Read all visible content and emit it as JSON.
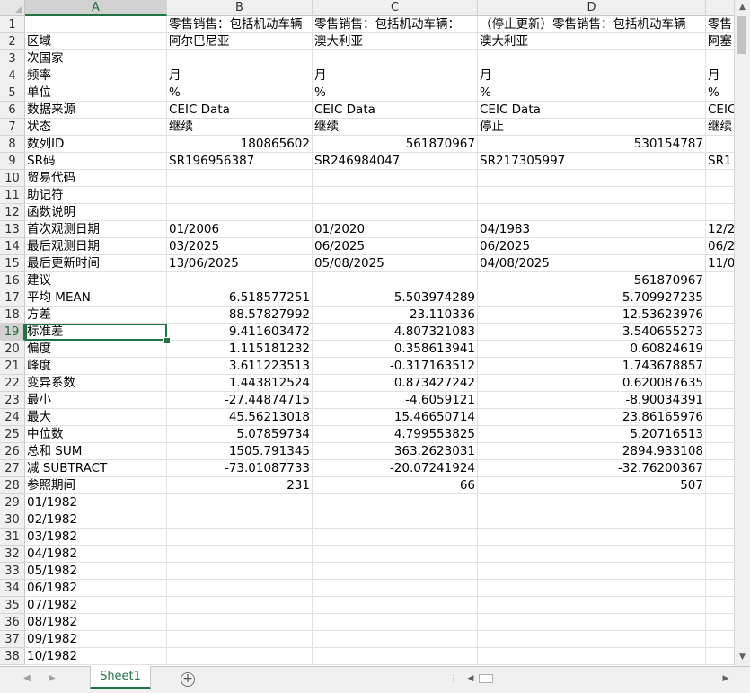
{
  "columns": [
    "A",
    "B",
    "C",
    "D",
    ""
  ],
  "active_cell": {
    "row": 19,
    "col": "A"
  },
  "row_numbers": [
    "1",
    "2",
    "3",
    "4",
    "5",
    "6",
    "7",
    "8",
    "9",
    "10",
    "11",
    "12",
    "13",
    "14",
    "15",
    "16",
    "17",
    "18",
    "19",
    "20",
    "21",
    "22",
    "23",
    "24",
    "25",
    "26",
    "27",
    "28",
    "29",
    "30",
    "31",
    "32",
    "33",
    "34",
    "35",
    "36",
    "37",
    "38"
  ],
  "rows": [
    [
      "",
      "零售销售：包括机动车辆",
      "零售销售：包括机动车辆：",
      "（停止更新）零售销售：包括机动车辆",
      "零售"
    ],
    [
      "区域",
      "阿尔巴尼亚",
      "澳大利亚",
      "澳大利亚",
      "阿塞"
    ],
    [
      "次国家",
      "",
      "",
      "",
      ""
    ],
    [
      "频率",
      "月",
      "月",
      "月",
      "月"
    ],
    [
      "单位",
      "%",
      "%",
      "%",
      "%"
    ],
    [
      "数据来源",
      "CEIC Data",
      "CEIC Data",
      "CEIC Data",
      "CEIC"
    ],
    [
      "状态",
      "继续",
      "继续",
      "停止",
      "继续"
    ],
    [
      "数列ID",
      "180865602",
      "561870967",
      "530154787",
      ""
    ],
    [
      "SR码",
      "SR196956387",
      "SR246984047",
      "SR217305997",
      "SR1"
    ],
    [
      "贸易代码",
      "",
      "",
      "",
      ""
    ],
    [
      "助记符",
      "",
      "",
      "",
      ""
    ],
    [
      "函数说明",
      "",
      "",
      "",
      ""
    ],
    [
      "首次观测日期",
      "01/2006",
      "01/2020",
      "04/1983",
      "12/2"
    ],
    [
      "最后观测日期",
      "03/2025",
      "06/2025",
      "06/2025",
      "06/2"
    ],
    [
      "最后更新时间",
      "13/06/2025",
      "05/08/2025",
      "04/08/2025",
      "11/0"
    ],
    [
      "建议",
      "",
      "",
      "561870967",
      ""
    ],
    [
      "平均 MEAN",
      "6.518577251",
      "5.503974289",
      "5.709927235",
      ""
    ],
    [
      "方差",
      "88.57827992",
      "23.110336",
      "12.53623976",
      ""
    ],
    [
      "标准差",
      "9.411603472",
      "4.807321083",
      "3.540655273",
      ""
    ],
    [
      "偏度",
      "1.115181232",
      "0.358613941",
      "0.60824619",
      ""
    ],
    [
      "峰度",
      "3.611223513",
      "-0.317163512",
      "1.743678857",
      ""
    ],
    [
      "变异系数",
      "1.443812524",
      "0.873427242",
      "0.620087635",
      ""
    ],
    [
      "最小",
      "-27.44874715",
      "-4.6059121",
      "-8.90034391",
      ""
    ],
    [
      "最大",
      "45.56213018",
      "15.46650714",
      "23.86165976",
      ""
    ],
    [
      "中位数",
      "5.07859734",
      "4.799553825",
      "5.20716513",
      ""
    ],
    [
      "总和 SUM",
      "1505.791345",
      "363.2623031",
      "2894.933108",
      ""
    ],
    [
      "减 SUBTRACT",
      "-73.01087733",
      "-20.07241924",
      "-32.76200367",
      ""
    ],
    [
      "参照期间",
      "231",
      "66",
      "507",
      ""
    ],
    [
      "01/1982",
      "",
      "",
      "",
      ""
    ],
    [
      "02/1982",
      "",
      "",
      "",
      ""
    ],
    [
      "03/1982",
      "",
      "",
      "",
      ""
    ],
    [
      "04/1982",
      "",
      "",
      "",
      ""
    ],
    [
      "05/1982",
      "",
      "",
      "",
      ""
    ],
    [
      "06/1982",
      "",
      "",
      "",
      ""
    ],
    [
      "07/1982",
      "",
      "",
      "",
      ""
    ],
    [
      "08/1982",
      "",
      "",
      "",
      ""
    ],
    [
      "09/1982",
      "",
      "",
      "",
      ""
    ],
    [
      "10/1982",
      "",
      "",
      "",
      ""
    ]
  ],
  "numeric_rows": [
    8,
    16,
    17,
    18,
    19,
    20,
    21,
    22,
    23,
    24,
    25,
    26,
    27,
    28
  ],
  "sheet_tab": "Sheet1",
  "add_sheet_symbol": "+",
  "split_dots": "⋮",
  "arrows": {
    "left": "◀",
    "right": "▶",
    "up": "▲",
    "down": "▼"
  }
}
